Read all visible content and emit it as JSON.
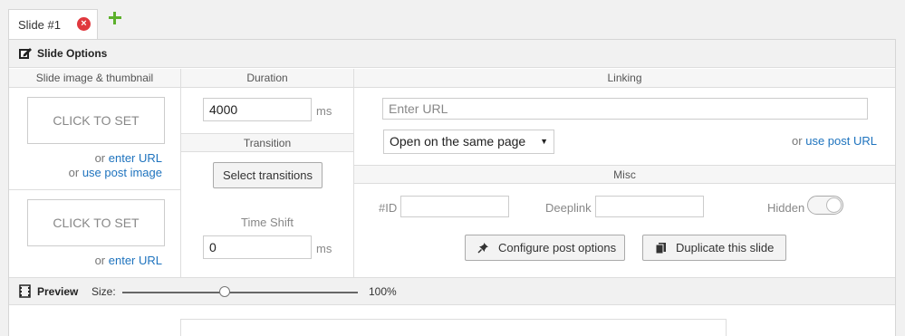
{
  "tabs": {
    "active_label": "Slide #1",
    "close_icon": "close-icon",
    "add_icon": "plus-icon"
  },
  "slide_options": {
    "title": "Slide Options",
    "icon": "edit-icon"
  },
  "image_column": {
    "title": "Slide image & thumbnail",
    "image": {
      "button": "CLICK TO SET",
      "or1": "or",
      "enter_url": "enter URL",
      "or2": "or",
      "use_post_image": "use post image"
    },
    "thumbnail": {
      "button": "CLICK TO SET",
      "or": "or",
      "enter_url": "enter URL"
    }
  },
  "duration_column": {
    "title": "Duration",
    "value": "4000",
    "unit": "ms",
    "transition_title": "Transition",
    "select_transitions": "Select transitions",
    "time_shift_label": "Time Shift",
    "time_shift_value": "0",
    "time_shift_unit": "ms"
  },
  "linking": {
    "title": "Linking",
    "url_placeholder": "Enter URL",
    "target_selected": "Open on the same page",
    "or": "or",
    "use_post_url": "use post URL"
  },
  "misc": {
    "title": "Misc",
    "id_label": "#ID",
    "deeplink_label": "Deeplink",
    "hidden_label": "Hidden",
    "hidden_on": false,
    "configure_button": "Configure post options",
    "configure_icon": "pin-icon",
    "duplicate_button": "Duplicate this slide",
    "duplicate_icon": "copy-icon"
  },
  "preview": {
    "title": "Preview",
    "icon": "film-icon",
    "size_label": "Size:",
    "zoom_value": "100%",
    "zoom_fraction": 0.43
  },
  "colors": {
    "link": "#1e73be",
    "close": "#e0383e",
    "add": "#5cb02b"
  }
}
